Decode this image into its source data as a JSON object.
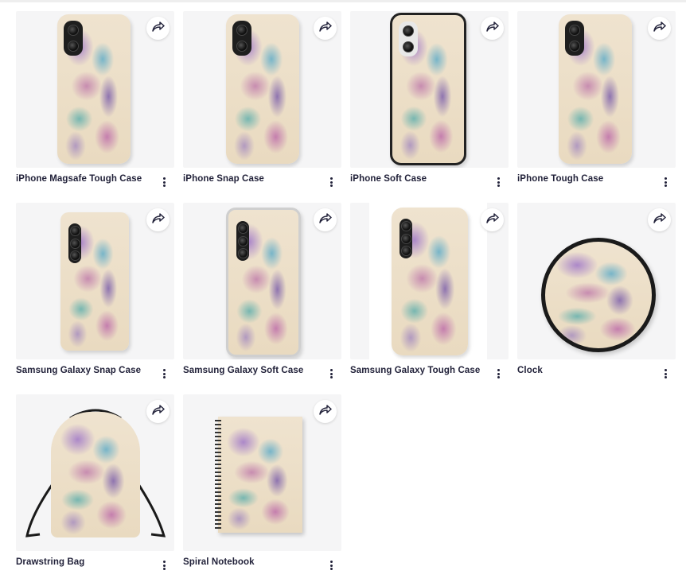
{
  "products": [
    {
      "id": "iphone-magsafe-tough-case",
      "title": "iPhone Magsafe Tough Case",
      "kind": "phone-iphone-tough"
    },
    {
      "id": "iphone-snap-case",
      "title": "iPhone Snap Case",
      "kind": "phone-iphone-snap"
    },
    {
      "id": "iphone-soft-case",
      "title": "iPhone Soft Case",
      "kind": "phone-iphone-soft"
    },
    {
      "id": "iphone-tough-case",
      "title": "iPhone Tough Case",
      "kind": "phone-iphone-tough"
    },
    {
      "id": "samsung-galaxy-snap-case",
      "title": "Samsung Galaxy Snap Case",
      "kind": "phone-samsung-snap"
    },
    {
      "id": "samsung-galaxy-soft-case",
      "title": "Samsung Galaxy Soft Case",
      "kind": "phone-samsung-soft"
    },
    {
      "id": "samsung-galaxy-tough-case",
      "title": "Samsung Galaxy Tough Case",
      "kind": "phone-samsung-tough"
    },
    {
      "id": "clock",
      "title": "Clock",
      "kind": "clock"
    },
    {
      "id": "drawstring-bag",
      "title": "Drawstring Bag",
      "kind": "bag"
    },
    {
      "id": "spiral-notebook",
      "title": "Spiral Notebook",
      "kind": "notebook"
    }
  ],
  "icons": {
    "share": "share-icon",
    "more": "more-vertical-icon"
  },
  "colors": {
    "label": "#22223a",
    "card_bg": "#f5f5f6"
  }
}
